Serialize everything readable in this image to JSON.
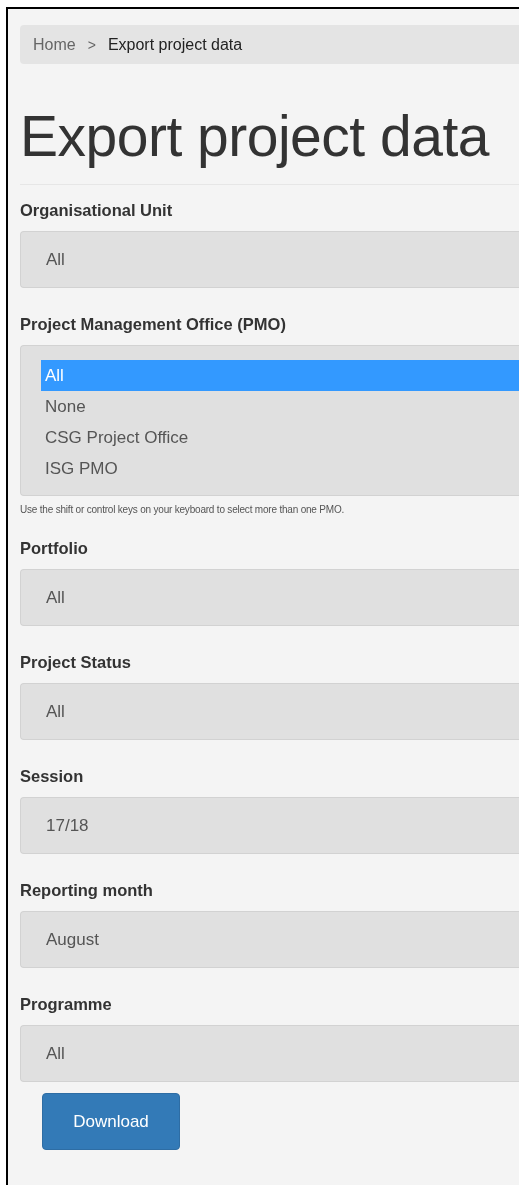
{
  "breadcrumb": {
    "separator": ">",
    "items": [
      {
        "label": "Home",
        "kind": "link"
      },
      {
        "label": "Export project data",
        "kind": "current"
      }
    ]
  },
  "title": "Export project data",
  "fields": [
    {
      "kind": "select",
      "label": "Organisational Unit",
      "value": "All"
    },
    {
      "kind": "listbox",
      "label": "Project Management Office (PMO)",
      "options": [
        {
          "label": "All",
          "selected": true
        },
        {
          "label": "None",
          "selected": false
        },
        {
          "label": "CSG Project Office",
          "selected": false
        },
        {
          "label": "ISG PMO",
          "selected": false
        }
      ],
      "help": "Use the shift or control keys on your keyboard to select more than one PMO."
    },
    {
      "kind": "select",
      "label": "Portfolio",
      "value": "All"
    },
    {
      "kind": "select",
      "label": "Project Status",
      "value": "All"
    },
    {
      "kind": "select",
      "label": "Session",
      "value": "17/18"
    },
    {
      "kind": "select",
      "label": "Reporting month",
      "value": "August"
    },
    {
      "kind": "select",
      "label": "Programme",
      "value": "All"
    }
  ],
  "download_button": "Download"
}
